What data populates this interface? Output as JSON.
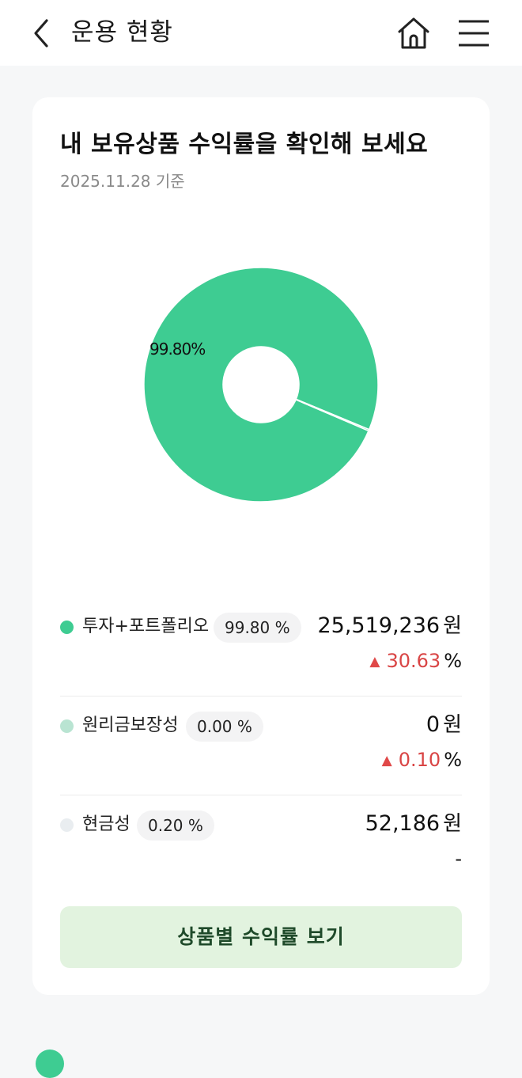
{
  "header": {
    "title": "운용 현황",
    "back_icon": "chevron-left-icon",
    "home_icon": "home-icon",
    "menu_icon": "hamburger-menu-icon"
  },
  "card": {
    "title": "내 보유상품 수익률을 확인해 보세요",
    "date": "2025.11.28 기준"
  },
  "chart_data": {
    "type": "pie",
    "donut": true,
    "categories": [
      "투자+포트폴리오",
      "원리금보장성",
      "현금성"
    ],
    "values": [
      99.8,
      0.0,
      0.2
    ],
    "colors": [
      "#3ecc92",
      "#b9e4d2",
      "#e9edf0"
    ],
    "slice_labels": [
      "99.80%",
      "",
      ""
    ]
  },
  "rows": [
    {
      "name": "투자+포트폴리오",
      "pct": "99.80 %",
      "amount": "25,519,236",
      "unit": "원",
      "rate": "30.63",
      "rate_unit": "%",
      "rate_dir": "▲",
      "dot_color": "#3ecc92"
    },
    {
      "name": "원리금보장성",
      "pct": "0.00 %",
      "amount": "0",
      "unit": "원",
      "rate": "0.10",
      "rate_unit": "%",
      "rate_dir": "▲",
      "dot_color": "#b9e4d2"
    },
    {
      "name": "현금성",
      "pct": "0.20 %",
      "amount": "52,186",
      "unit": "원",
      "rate_text": "-",
      "dot_color": "#e9edf0"
    }
  ],
  "button": {
    "label": "상품별 수익률 보기"
  },
  "colors": {
    "accent": "#3ecc92",
    "up": "#d94545",
    "button_bg": "#e2f3df"
  }
}
